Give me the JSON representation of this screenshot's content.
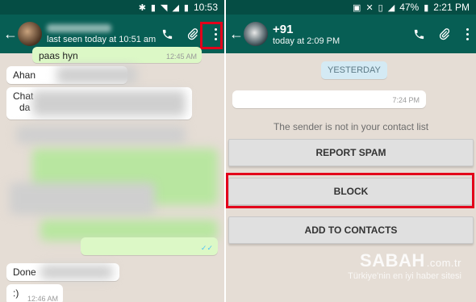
{
  "left": {
    "status": {
      "time": "10:53"
    },
    "header": {
      "subtitle": "last seen today at 10:51 am"
    },
    "messages": [
      {
        "text": "paas hyn",
        "time": "12:45 AM"
      },
      {
        "text": "Ahan"
      },
      {
        "text": "Chat"
      },
      {
        "text": "da"
      },
      {
        "text": "Done"
      },
      {
        "text": ":)",
        "time": "12:46 AM"
      }
    ]
  },
  "right": {
    "status": {
      "battery": "47%",
      "time": "2:21 PM"
    },
    "header": {
      "title": "+91",
      "subtitle": "today at 2:09 PM"
    },
    "date_chip": "YESTERDAY",
    "bubble_time": "7:24 PM",
    "notice": "The sender is not in your contact list",
    "buttons": {
      "report": "REPORT SPAM",
      "block": "BLOCK",
      "add": "ADD TO CONTACTS"
    }
  },
  "watermark": {
    "brand": "SABAH",
    "tld": ".com.tr",
    "tagline": "Türkiye'nin en iyi haber sitesi"
  },
  "colors": {
    "header": "#075e54",
    "statusbar": "#054d44",
    "chat_bg": "#e5ddd5",
    "outgoing": "#dcf8c6",
    "highlight": "#e3001b"
  }
}
